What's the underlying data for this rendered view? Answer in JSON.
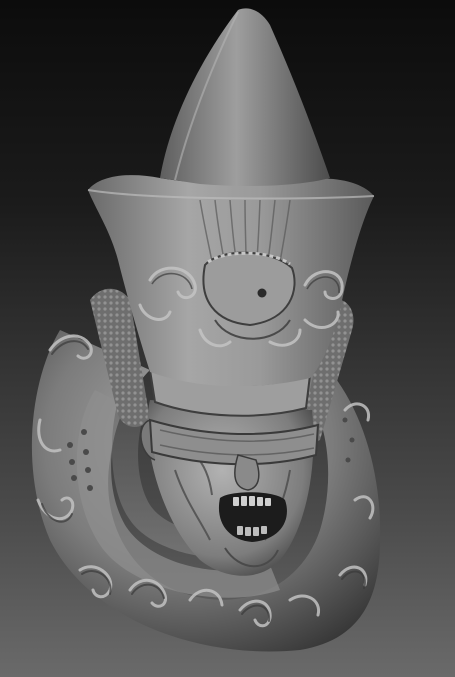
{
  "scene": {
    "subject": "sculpt-render",
    "colors": {
      "background_top": "#0c0c0c",
      "background_bottom": "#6a6a6a",
      "clay_light": "#b9b9b9",
      "clay_mid": "#8a8a8a",
      "clay_dark": "#3e3e3e",
      "clay_shadow": "#242424"
    }
  }
}
